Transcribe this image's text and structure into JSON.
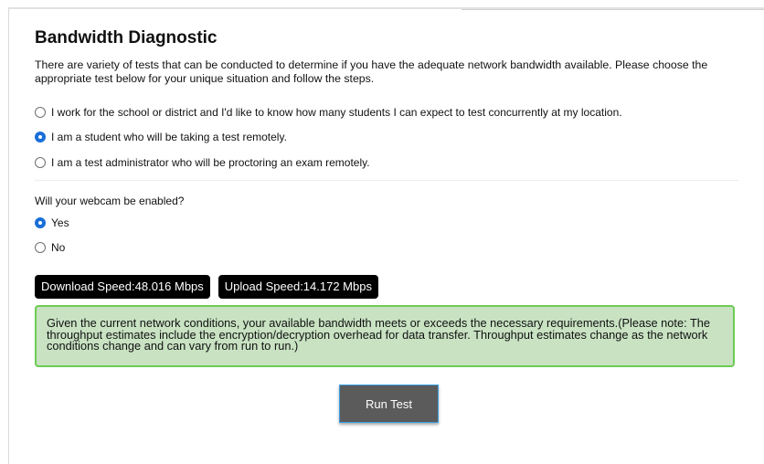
{
  "page": {
    "title": "Bandwidth Diagnostic",
    "description": "There are variety of tests that can be conducted to determine if you have the adequate network bandwidth available. Please choose the appropriate test below for your unique situation and follow the steps."
  },
  "test_options": [
    {
      "label": "I work for the school or district and I'd like to know how many students I can expect to test concurrently at my location.",
      "checked": false
    },
    {
      "label": "I am a student who will be taking a test remotely.",
      "checked": true
    },
    {
      "label": "I am a test administrator who will be proctoring an exam remotely.",
      "checked": false
    }
  ],
  "webcam": {
    "question": "Will your webcam be enabled?",
    "options": [
      {
        "label": "Yes",
        "checked": true
      },
      {
        "label": "No",
        "checked": false
      }
    ]
  },
  "results": {
    "download_label": "Download Speed:48.016 Mbps",
    "upload_label": "Upload Speed:14.172 Mbps",
    "message": "Given the current network conditions, your available bandwidth meets or exceeds the necessary requirements.(Please note: The throughput estimates include the encryption/decryption overhead for data transfer. Throughput estimates change as the network conditions change and can vary from run to run.)"
  },
  "actions": {
    "run_test_label": "Run Test"
  },
  "colors": {
    "accent": "#1a6fd8",
    "success_bg": "#c8e2c2",
    "success_border": "#6dcb55",
    "button_bg": "#5b5b5b"
  }
}
